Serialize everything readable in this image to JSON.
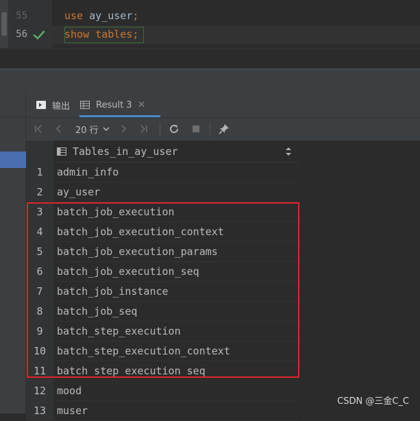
{
  "editor": {
    "lines": [
      {
        "number": "55",
        "keyword": "use",
        "rest": " ay_user",
        "semicolon": ";"
      },
      {
        "number": "56",
        "keyword": "show",
        "rest": " tables",
        "semicolon": ";"
      }
    ],
    "status_icon": "check-icon",
    "check_color": "#59a869"
  },
  "tabs": [
    {
      "label": "输出",
      "icon": "console-output-icon"
    },
    {
      "label": "Result 3",
      "icon": "table-icon",
      "active": true
    }
  ],
  "toolbar": {
    "rows_label": "20 行",
    "icons": [
      "first-page-icon",
      "previous-page-icon",
      "rows-dropdown-chevron-icon",
      "next-page-icon",
      "last-page-icon",
      "refresh-icon",
      "stop-icon",
      "pin-icon"
    ]
  },
  "grid": {
    "column_header": "Tables_in_ay_user",
    "rows": [
      {
        "n": "1",
        "value": "admin_info"
      },
      {
        "n": "2",
        "value": "ay_user"
      },
      {
        "n": "3",
        "value": "batch_job_execution"
      },
      {
        "n": "4",
        "value": "batch_job_execution_context"
      },
      {
        "n": "5",
        "value": "batch_job_execution_params"
      },
      {
        "n": "6",
        "value": "batch_job_execution_seq"
      },
      {
        "n": "7",
        "value": "batch_job_instance"
      },
      {
        "n": "8",
        "value": "batch_job_seq"
      },
      {
        "n": "9",
        "value": "batch_step_execution"
      },
      {
        "n": "10",
        "value": "batch_step_execution_context"
      },
      {
        "n": "11",
        "value": "batch_step_execution_seq"
      },
      {
        "n": "12",
        "value": "mood"
      },
      {
        "n": "13",
        "value": "muser"
      }
    ],
    "highlight_color": "#e0242b"
  },
  "watermark": "CSDN @三金C_C"
}
